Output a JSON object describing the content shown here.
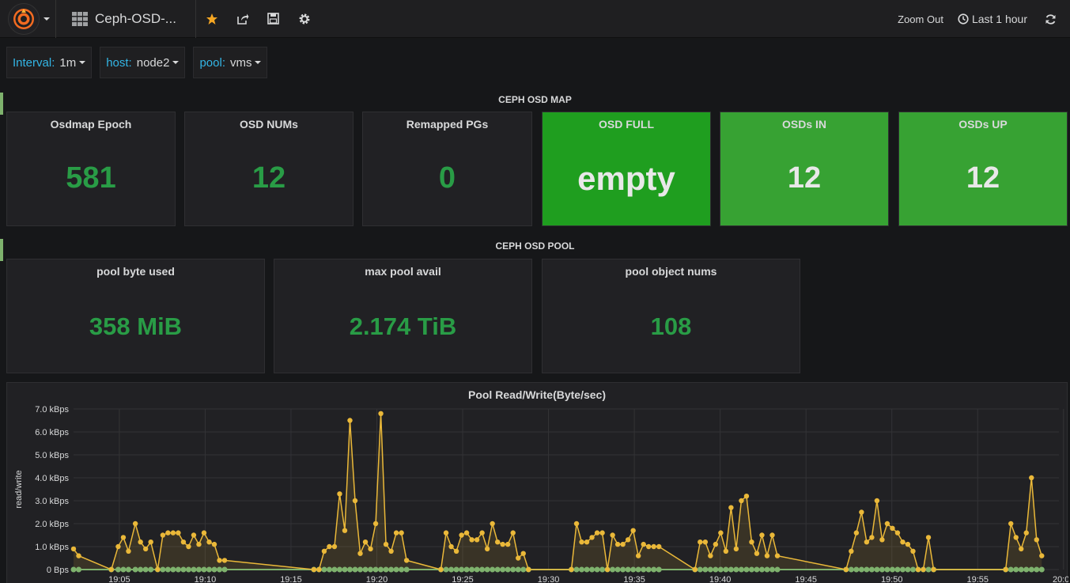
{
  "nav": {
    "dashboard_title": "Ceph-OSD-...",
    "zoom_out": "Zoom Out",
    "time_range": "Last 1 hour"
  },
  "vars": [
    {
      "label": "Interval:",
      "value": "1m"
    },
    {
      "label": "host:",
      "value": "node2"
    },
    {
      "label": "pool:",
      "value": "vms"
    }
  ],
  "rows": {
    "osd_map": "CEPH OSD MAP",
    "osd_pool": "CEPH OSD POOL"
  },
  "map_panels": [
    {
      "title": "Osdmap Epoch",
      "value": "581"
    },
    {
      "title": "OSD NUMs",
      "value": "12"
    },
    {
      "title": "Remapped PGs",
      "value": "0"
    },
    {
      "title": "OSD FULL",
      "value": "empty"
    },
    {
      "title": "OSDs IN",
      "value": "12"
    },
    {
      "title": "OSDs UP",
      "value": "12"
    }
  ],
  "pool_panels": [
    {
      "title": "pool byte used",
      "value": "358 MiB"
    },
    {
      "title": "max pool avail",
      "value": "2.174 TiB"
    },
    {
      "title": "pool object nums",
      "value": "108"
    }
  ],
  "colors": {
    "accent": "#33b5e5",
    "stat_green": "#299c46",
    "bg_green_full": "#1f9e1f",
    "bg_green": "#37a233",
    "series_read_write": "#eab839",
    "series_baseline": "#7eb26d",
    "star": "#f5a623"
  },
  "icons": [
    "grafana-logo-icon",
    "dashboard-grid-icon",
    "star-icon",
    "share-icon",
    "save-icon",
    "gear-icon",
    "clock-icon",
    "refresh-icon"
  ],
  "chart_data": {
    "type": "line",
    "title": "Pool Read/Write(Byte/sec)",
    "ylabel": "read/write",
    "xlabel": "",
    "ylim": [
      0,
      7
    ],
    "yticks": [
      "0 Bps",
      "1.0 kBps",
      "2.0 kBps",
      "3.0 kBps",
      "4.0 kBps",
      "5.0 kBps",
      "6.0 kBps",
      "7.0 kBps"
    ],
    "xticks": [
      "19:05",
      "19:10",
      "19:15",
      "19:20",
      "19:25",
      "19:30",
      "19:35",
      "19:40",
      "19:45",
      "19:50",
      "19:55",
      "20:00"
    ],
    "xstart": "19:02:20",
    "series": [
      {
        "values_kBps": [
          [
            0.0,
            0.9
          ],
          [
            0.3,
            0.6
          ],
          [
            2.2,
            0
          ],
          [
            2.6,
            1.0
          ],
          [
            2.9,
            1.4
          ],
          [
            3.2,
            0.8
          ],
          [
            3.6,
            2.0
          ],
          [
            3.9,
            1.2
          ],
          [
            4.2,
            0.9
          ],
          [
            4.5,
            1.2
          ],
          [
            4.9,
            0
          ],
          [
            5.2,
            1.5
          ],
          [
            5.5,
            1.6
          ],
          [
            5.8,
            1.6
          ],
          [
            6.1,
            1.6
          ],
          [
            6.4,
            1.2
          ],
          [
            6.7,
            1.0
          ],
          [
            7.0,
            1.5
          ],
          [
            7.3,
            1.1
          ],
          [
            7.6,
            1.6
          ],
          [
            7.9,
            1.2
          ],
          [
            8.2,
            1.1
          ],
          [
            8.5,
            0.4
          ],
          [
            8.8,
            0.4
          ],
          [
            14.0,
            0
          ],
          [
            14.3,
            0
          ],
          [
            14.6,
            0.8
          ],
          [
            14.9,
            1.0
          ],
          [
            15.2,
            1.0
          ],
          [
            15.5,
            3.3
          ],
          [
            15.8,
            1.7
          ],
          [
            16.1,
            6.5
          ],
          [
            16.4,
            3.0
          ],
          [
            16.7,
            0.7
          ],
          [
            17.0,
            1.2
          ],
          [
            17.3,
            0.9
          ],
          [
            17.6,
            2.0
          ],
          [
            17.9,
            6.8
          ],
          [
            18.2,
            1.1
          ],
          [
            18.5,
            0.8
          ],
          [
            18.8,
            1.6
          ],
          [
            19.1,
            1.6
          ],
          [
            19.4,
            0.4
          ],
          [
            21.4,
            0
          ],
          [
            21.7,
            1.6
          ],
          [
            22.0,
            1.0
          ],
          [
            22.3,
            0.8
          ],
          [
            22.6,
            1.5
          ],
          [
            22.9,
            1.6
          ],
          [
            23.2,
            1.3
          ],
          [
            23.5,
            1.3
          ],
          [
            23.8,
            1.6
          ],
          [
            24.1,
            0.9
          ],
          [
            24.4,
            2.0
          ],
          [
            24.7,
            1.2
          ],
          [
            25.0,
            1.1
          ],
          [
            25.3,
            1.1
          ],
          [
            25.6,
            1.6
          ],
          [
            25.9,
            0.5
          ],
          [
            26.2,
            0.7
          ],
          [
            26.5,
            0
          ],
          [
            29.0,
            0
          ],
          [
            29.3,
            2.0
          ],
          [
            29.6,
            1.2
          ],
          [
            29.9,
            1.2
          ],
          [
            30.2,
            1.4
          ],
          [
            30.5,
            1.6
          ],
          [
            30.8,
            1.6
          ],
          [
            31.1,
            0
          ],
          [
            31.4,
            1.5
          ],
          [
            31.7,
            1.1
          ],
          [
            32.0,
            1.1
          ],
          [
            32.3,
            1.3
          ],
          [
            32.6,
            1.7
          ],
          [
            32.9,
            0.6
          ],
          [
            33.2,
            1.1
          ],
          [
            33.5,
            1.0
          ],
          [
            33.8,
            1.0
          ],
          [
            34.1,
            1.0
          ],
          [
            36.2,
            0
          ],
          [
            36.5,
            1.2
          ],
          [
            36.8,
            1.2
          ],
          [
            37.1,
            0.6
          ],
          [
            37.4,
            1.1
          ],
          [
            37.7,
            1.6
          ],
          [
            38.0,
            0.8
          ],
          [
            38.3,
            2.7
          ],
          [
            38.6,
            0.9
          ],
          [
            38.9,
            3.0
          ],
          [
            39.2,
            3.2
          ],
          [
            39.5,
            1.2
          ],
          [
            39.8,
            0.7
          ],
          [
            40.1,
            1.5
          ],
          [
            40.4,
            0.6
          ],
          [
            40.7,
            1.5
          ],
          [
            41.0,
            0.6
          ],
          [
            45.0,
            0
          ],
          [
            45.3,
            0.8
          ],
          [
            45.6,
            1.6
          ],
          [
            45.9,
            2.5
          ],
          [
            46.2,
            1.2
          ],
          [
            46.5,
            1.4
          ],
          [
            46.8,
            3.0
          ],
          [
            47.1,
            1.3
          ],
          [
            47.4,
            2.0
          ],
          [
            47.7,
            1.8
          ],
          [
            48.0,
            1.6
          ],
          [
            48.3,
            1.2
          ],
          [
            48.6,
            1.1
          ],
          [
            48.9,
            0.8
          ],
          [
            49.2,
            0
          ],
          [
            49.5,
            0
          ],
          [
            49.8,
            1.4
          ],
          [
            50.1,
            0
          ],
          [
            54.3,
            0
          ],
          [
            54.6,
            2.0
          ],
          [
            54.9,
            1.4
          ],
          [
            55.2,
            0.9
          ],
          [
            55.5,
            1.6
          ],
          [
            55.8,
            4.0
          ],
          [
            56.1,
            1.3
          ],
          [
            56.4,
            0.6
          ]
        ]
      },
      {
        "values_kBps": "0 at every sample"
      }
    ]
  }
}
